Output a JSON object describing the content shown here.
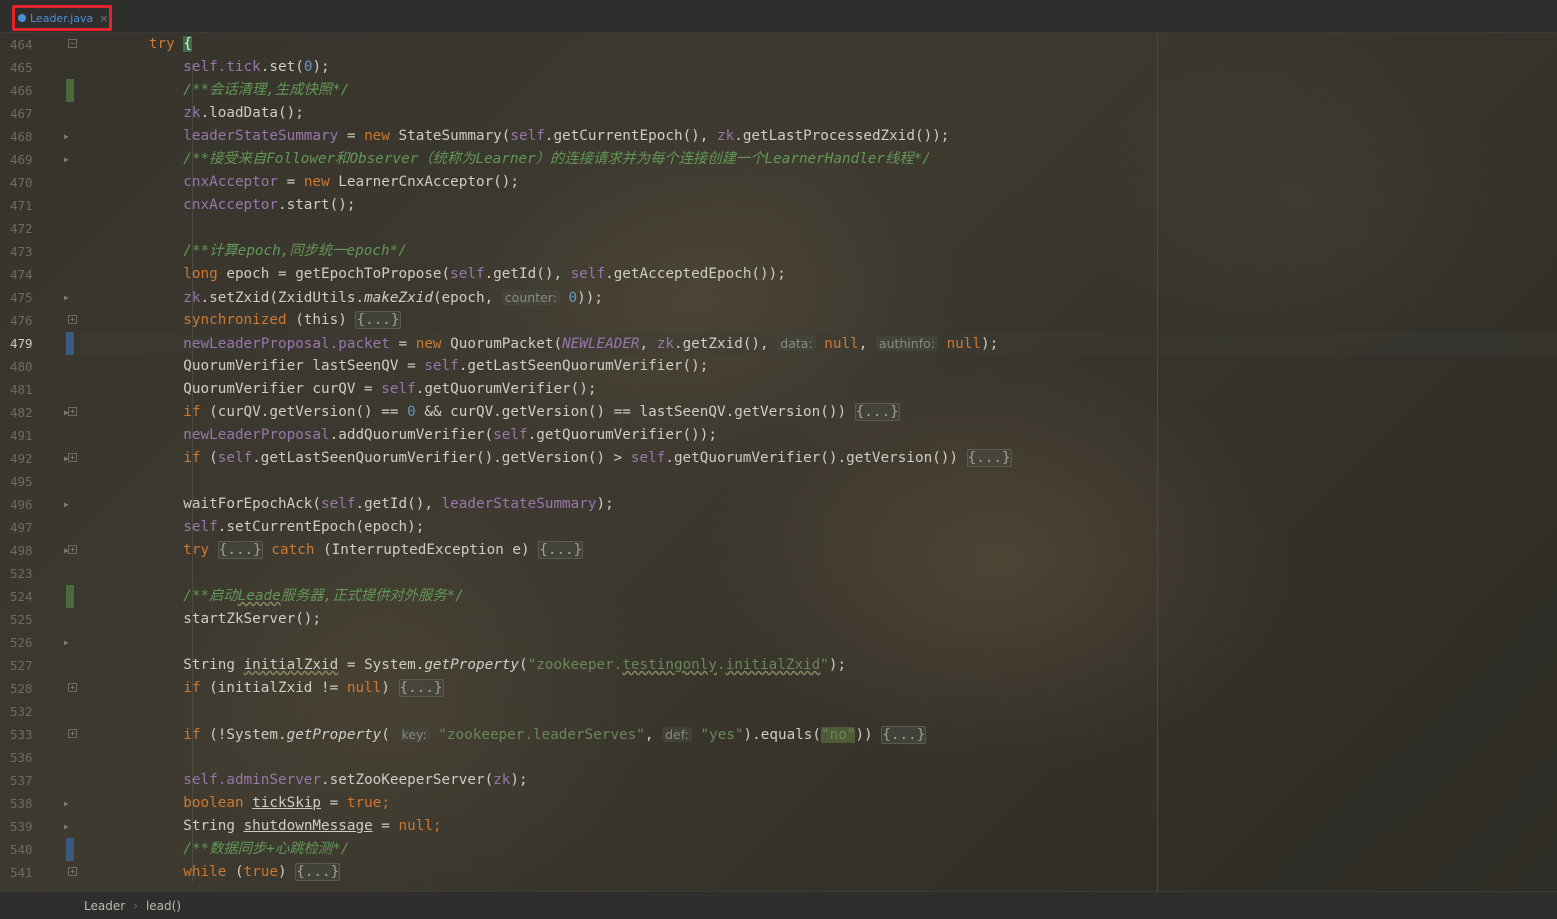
{
  "tab": {
    "label": "Leader.java",
    "close": "×"
  },
  "breadcrumb": {
    "class_name": "Leader",
    "method_name": "lead()"
  },
  "current_line": "479",
  "lines": [
    {
      "n": "464",
      "fold": "open"
    },
    {
      "n": "465"
    },
    {
      "n": "466",
      "mark": "green"
    },
    {
      "n": "467"
    },
    {
      "n": "468",
      "arrow": true
    },
    {
      "n": "469",
      "arrow": true
    },
    {
      "n": "470"
    },
    {
      "n": "471"
    },
    {
      "n": "472"
    },
    {
      "n": "473"
    },
    {
      "n": "474"
    },
    {
      "n": "475",
      "arrow": true
    },
    {
      "n": "476",
      "fold": "closed"
    },
    {
      "n": "479",
      "mark": "blue"
    },
    {
      "n": "480"
    },
    {
      "n": "481"
    },
    {
      "n": "482",
      "fold": "closed",
      "arrow": true
    },
    {
      "n": "491"
    },
    {
      "n": "492",
      "fold": "closed",
      "arrow": true
    },
    {
      "n": "495"
    },
    {
      "n": "496",
      "arrow": true
    },
    {
      "n": "497"
    },
    {
      "n": "498",
      "fold": "closed",
      "arrow": true
    },
    {
      "n": "523"
    },
    {
      "n": "524",
      "mark": "green"
    },
    {
      "n": "525"
    },
    {
      "n": "526",
      "arrow": true
    },
    {
      "n": "527"
    },
    {
      "n": "528",
      "fold": "closed"
    },
    {
      "n": "532"
    },
    {
      "n": "533",
      "fold": "closed"
    },
    {
      "n": "536"
    },
    {
      "n": "537"
    },
    {
      "n": "538",
      "arrow": true
    },
    {
      "n": "539",
      "arrow": true
    },
    {
      "n": "540",
      "mark": "blue"
    },
    {
      "n": "541",
      "fold": "closed"
    }
  ],
  "code": {
    "l464": {
      "try": "try",
      "brace": "{"
    },
    "l465": {
      "self": "self",
      "tick": ".tick",
      "set": ".set(",
      "zero": "0",
      "end": ");"
    },
    "l466": {
      "comment": "/**会话清理,生成快照*/"
    },
    "l467": {
      "zk": "zk",
      "call": ".loadData();"
    },
    "l468": {
      "lhs": "leaderStateSummary",
      "eq": " = ",
      "new": "new",
      "cls": " StateSummary(",
      "self": "self",
      "m1": ".getCurrentEpoch(), ",
      "zk": "zk",
      "m2": ".getLastProcessedZxid());"
    },
    "l469": {
      "comment": "/**接受来自Follower和Observer（统称为Learner）的连接请求并为每个连接创建一个LearnerHandler线程*/"
    },
    "l470": {
      "lhs": "cnxAcceptor",
      "eq": " = ",
      "new": "new",
      "rest": " LearnerCnxAcceptor();"
    },
    "l471": {
      "obj": "cnxAcceptor",
      "rest": ".start();"
    },
    "l473": {
      "comment": "/**计算epoch,同步统一epoch*/"
    },
    "l474": {
      "type": "long",
      "mid": " epoch = getEpochToPropose(",
      "self1": "self",
      "m1": ".getId(), ",
      "self2": "self",
      "m2": ".getAcceptedEpoch());"
    },
    "l475": {
      "zk": "zk",
      "a": ".setZxid(ZxidUtils.",
      "fn": "makeZxid",
      "b": "(epoch, ",
      "hint": "counter:",
      "zero": "0",
      "end": "));"
    },
    "l476": {
      "kw": "synchronized",
      "mid": " (this) ",
      "fold": "{...}"
    },
    "l479": {
      "obj": "newLeaderProposal",
      "f": ".packet",
      "eq": " = ",
      "new": "new",
      "cls": " QuorumPacket(",
      "cst": "NEWLEADER",
      "c1": ", ",
      "zk": "zk",
      "m": ".getZxid(), ",
      "h1": "data:",
      "n1": " null",
      "c2": ", ",
      "h2": "authinfo:",
      "n2": " null",
      "end": ");"
    },
    "l480": {
      "a": "QuorumVerifier lastSeenQV = ",
      "self": "self",
      "b": ".getLastSeenQuorumVerifier();"
    },
    "l481": {
      "a": "QuorumVerifier curQV = ",
      "self": "self",
      "b": ".getQuorumVerifier();"
    },
    "l482": {
      "if": "if",
      "a": " (curQV.getVersion() == ",
      "zero": "0",
      "b": " && curQV.getVersion() == lastSeenQV.getVersion()) ",
      "fold": "{...}"
    },
    "l491": {
      "obj": "newLeaderProposal",
      "a": ".addQuorumVerifier(",
      "self": "self",
      "b": ".getQuorumVerifier());"
    },
    "l492": {
      "if": "if",
      "a": " (",
      "self1": "self",
      "b": ".getLastSeenQuorumVerifier().getVersion() > ",
      "self2": "self",
      "c": ".getQuorumVerifier().getVersion()) ",
      "fold": "{...}"
    },
    "l496": {
      "a": "waitForEpochAck(",
      "self": "self",
      "b": ".getId(), ",
      "fld": "leaderStateSummary",
      "c": ");"
    },
    "l497": {
      "self": "self",
      "b": ".setCurrentEpoch(epoch);"
    },
    "l498": {
      "try": "try",
      "fold1": "{...}",
      "catch": "catch",
      "b": " (InterruptedException e) ",
      "fold2": "{...}"
    },
    "l524": {
      "c1": "/**启动",
      "c2": "Leade",
      "c3": "服务器,正式提供对外服务*/"
    },
    "l525": {
      "a": "startZkServer();"
    },
    "l527": {
      "a": "String ",
      "v": "initialZxid",
      "b": " = System.",
      "fn": "getProperty",
      "c": "(",
      "s1": "\"zookeeper.",
      "s2": "testingonly",
      "s3": ".",
      "s4": "initialZxid",
      "s5": "\"",
      "d": ");"
    },
    "l528": {
      "if": "if",
      "a": " (initialZxid != ",
      "null": "null",
      "b": ") ",
      "fold": "{...}"
    },
    "l533": {
      "if": "if",
      "a": " (!System.",
      "fn": "getProperty",
      "b": "( ",
      "h1": "key:",
      "s1": " \"zookeeper.leaderServes\"",
      "c": ", ",
      "h2": "def:",
      "s2": " \"yes\"",
      "d": ").equals(",
      "s3": "\"no\"",
      "e": ")) ",
      "fold": "{...}"
    },
    "l537": {
      "self": "self",
      "f": ".adminServer",
      "a": ".setZooKeeperServer(",
      "zk": "zk",
      "b": ");"
    },
    "l538": {
      "type": "boolean",
      "a": " ",
      "v": "tickSkip",
      "b": " = ",
      "t": "true",
      "c": ";"
    },
    "l539": {
      "a": "String ",
      "v": "shutdownMessage",
      "b": " = ",
      "null": "null",
      "c": ";"
    },
    "l540": {
      "comment": "/**数据同步+心跳检测*/"
    },
    "l541": {
      "kw": "while",
      "a": " (",
      "t": "true",
      "b": ") ",
      "fold": "{...}"
    }
  }
}
